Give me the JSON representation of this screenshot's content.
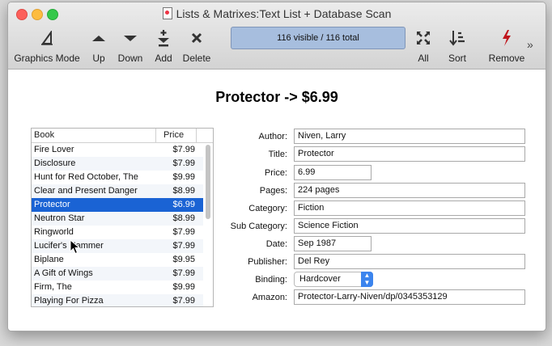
{
  "window": {
    "title": "Lists & Matrixes:Text List + Database Scan"
  },
  "toolbar": {
    "graphics_mode": "Graphics Mode",
    "up": "Up",
    "down": "Down",
    "add": "Add",
    "delete": "Delete",
    "status": "116 visible / 116 total",
    "all": "All",
    "sort": "Sort",
    "remove": "Remove",
    "overflow": "»"
  },
  "heading": "Protector -> $6.99",
  "list": {
    "columns": [
      "Book",
      "Price"
    ],
    "rows": [
      {
        "book": "Fire Lover",
        "price": "$7.99"
      },
      {
        "book": "Disclosure",
        "price": "$7.99"
      },
      {
        "book": "Hunt for Red October, The",
        "price": "$9.99"
      },
      {
        "book": "Clear and Present Danger",
        "price": "$8.99"
      },
      {
        "book": "Protector",
        "price": "$6.99",
        "selected": true
      },
      {
        "book": "Neutron Star",
        "price": "$8.99"
      },
      {
        "book": "Ringworld",
        "price": "$7.99"
      },
      {
        "book": "Lucifer's Hammer",
        "price": "$7.99"
      },
      {
        "book": "Biplane",
        "price": "$9.95"
      },
      {
        "book": "A Gift of Wings",
        "price": "$7.99"
      },
      {
        "book": "Firm, The",
        "price": "$9.99"
      },
      {
        "book": "Playing For Pizza",
        "price": "$7.99"
      }
    ]
  },
  "form": {
    "author": {
      "label": "Author:",
      "value": "Niven, Larry"
    },
    "title": {
      "label": "Title:",
      "value": "Protector"
    },
    "price": {
      "label": "Price:",
      "value": "6.99"
    },
    "pages": {
      "label": "Pages:",
      "value": "224 pages"
    },
    "category": {
      "label": "Category:",
      "value": "Fiction"
    },
    "sub_category": {
      "label": "Sub Category:",
      "value": "Science Fiction"
    },
    "date": {
      "label": "Date:",
      "value": "Sep 1987"
    },
    "publisher": {
      "label": "Publisher:",
      "value": "Del Rey"
    },
    "binding": {
      "label": "Binding:",
      "value": "Hardcover"
    },
    "amazon": {
      "label": "Amazon:",
      "value": "Protector-Larry-Niven/dp/0345353129"
    }
  },
  "colors": {
    "selection": "#1a63d4",
    "status_fill": "#a7bede",
    "remove_icon": "#c0161d"
  }
}
